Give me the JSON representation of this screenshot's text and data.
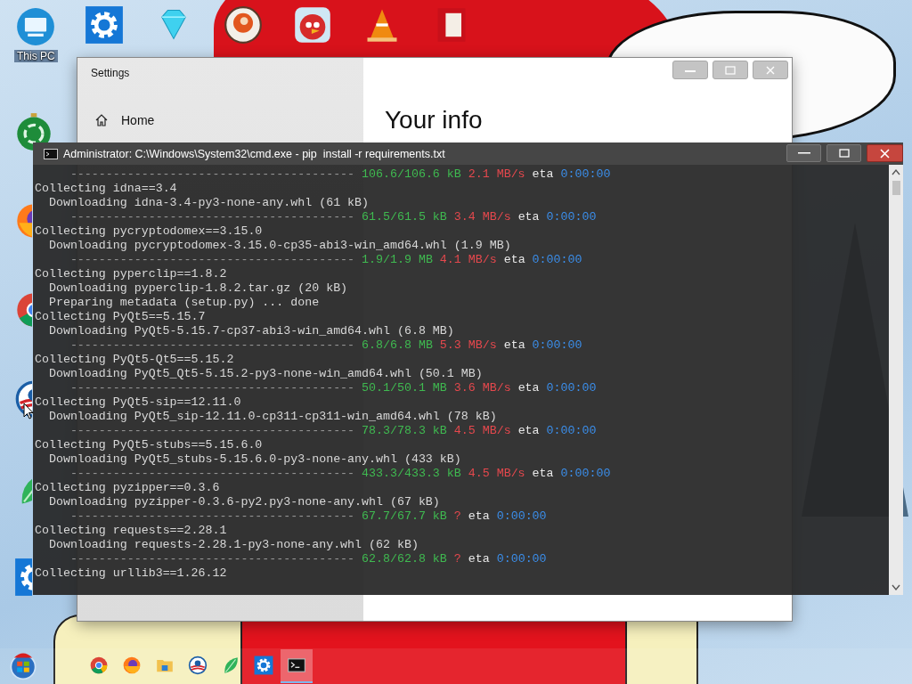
{
  "desktop": {
    "left_column": [
      {
        "kind": "monitor",
        "label": "This PC"
      },
      {
        "kind": "ornament"
      },
      {
        "kind": "globe"
      },
      {
        "kind": "wheel"
      },
      {
        "kind": "emblem"
      },
      {
        "kind": "leaf"
      },
      {
        "kind": "gear"
      }
    ],
    "top_row": [
      {
        "kind": "gear"
      },
      {
        "kind": "diamond"
      },
      {
        "kind": "ball"
      },
      {
        "kind": "bird"
      },
      {
        "kind": "cone"
      },
      {
        "kind": "card"
      }
    ]
  },
  "settings_window": {
    "title": "Settings",
    "nav": [
      {
        "label": "Home"
      }
    ],
    "heading": "Your info"
  },
  "cmd_window": {
    "title": "Administrator: C:\\Windows\\System32\\cmd.exe - pip  install -r requirements.txt",
    "lines": [
      {
        "kind": "progress",
        "bar": "----------------------------------------",
        "size": "106.6/106.6 kB",
        "speed": "2.1 MB/s",
        "eta_label": "eta",
        "eta": "0:00:00"
      },
      {
        "kind": "item",
        "text": "Collecting idna==3.4"
      },
      {
        "kind": "detail",
        "text": "Downloading idna-3.4-py3-none-any.whl (61 kB)"
      },
      {
        "kind": "progress",
        "bar": "----------------------------------------",
        "size": "61.5/61.5 kB",
        "speed": "3.4 MB/s",
        "eta_label": "eta",
        "eta": "0:00:00"
      },
      {
        "kind": "item",
        "text": "Collecting pycryptodomex==3.15.0"
      },
      {
        "kind": "detail",
        "text": "Downloading pycryptodomex-3.15.0-cp35-abi3-win_amd64.whl (1.9 MB)"
      },
      {
        "kind": "progress",
        "bar": "----------------------------------------",
        "size": "1.9/1.9 MB",
        "speed": "4.1 MB/s",
        "eta_label": "eta",
        "eta": "0:00:00"
      },
      {
        "kind": "item",
        "text": "Collecting pyperclip==1.8.2"
      },
      {
        "kind": "detail",
        "text": "Downloading pyperclip-1.8.2.tar.gz (20 kB)"
      },
      {
        "kind": "detail",
        "text": "Preparing metadata (setup.py) ... done"
      },
      {
        "kind": "item",
        "text": "Collecting PyQt5==5.15.7"
      },
      {
        "kind": "detail",
        "text": "Downloading PyQt5-5.15.7-cp37-abi3-win_amd64.whl (6.8 MB)"
      },
      {
        "kind": "progress",
        "bar": "----------------------------------------",
        "size": "6.8/6.8 MB",
        "speed": "5.3 MB/s",
        "eta_label": "eta",
        "eta": "0:00:00"
      },
      {
        "kind": "item",
        "text": "Collecting PyQt5-Qt5==5.15.2"
      },
      {
        "kind": "detail",
        "text": "Downloading PyQt5_Qt5-5.15.2-py3-none-win_amd64.whl (50.1 MB)"
      },
      {
        "kind": "progress",
        "bar": "----------------------------------------",
        "size": "50.1/50.1 MB",
        "speed": "3.6 MB/s",
        "eta_label": "eta",
        "eta": "0:00:00"
      },
      {
        "kind": "item",
        "text": "Collecting PyQt5-sip==12.11.0"
      },
      {
        "kind": "detail",
        "text": "Downloading PyQt5_sip-12.11.0-cp311-cp311-win_amd64.whl (78 kB)"
      },
      {
        "kind": "progress",
        "bar": "----------------------------------------",
        "size": "78.3/78.3 kB",
        "speed": "4.5 MB/s",
        "eta_label": "eta",
        "eta": "0:00:00"
      },
      {
        "kind": "item",
        "text": "Collecting PyQt5-stubs==5.15.6.0"
      },
      {
        "kind": "detail",
        "text": "Downloading PyQt5_stubs-5.15.6.0-py3-none-any.whl (433 kB)"
      },
      {
        "kind": "progress",
        "bar": "----------------------------------------",
        "size": "433.3/433.3 kB",
        "speed": "4.5 MB/s",
        "eta_label": "eta",
        "eta": "0:00:00"
      },
      {
        "kind": "item",
        "text": "Collecting pyzipper==0.3.6"
      },
      {
        "kind": "detail",
        "text": "Downloading pyzipper-0.3.6-py2.py3-none-any.whl (67 kB)"
      },
      {
        "kind": "progress",
        "bar": "----------------------------------------",
        "size": "67.7/67.7 kB",
        "speed": "?",
        "eta_label": "eta",
        "eta": "0:00:00"
      },
      {
        "kind": "item",
        "text": "Collecting requests==2.28.1"
      },
      {
        "kind": "detail",
        "text": "Downloading requests-2.28.1-py3-none-any.whl (62 kB)"
      },
      {
        "kind": "progress",
        "bar": "----------------------------------------",
        "size": "62.8/62.8 kB",
        "speed": "?",
        "eta_label": "eta",
        "eta": "0:00:00"
      },
      {
        "kind": "item",
        "text": "Collecting urllib3==1.26.12"
      }
    ]
  },
  "taskbar": {
    "items": [
      {
        "kind": "start",
        "selected": false
      },
      {
        "kind": "wheel",
        "selected": false
      },
      {
        "kind": "globe",
        "selected": false
      },
      {
        "kind": "folder",
        "selected": false
      },
      {
        "kind": "emblem",
        "selected": false
      },
      {
        "kind": "leaf",
        "selected": false
      },
      {
        "kind": "gear",
        "selected": false
      },
      {
        "kind": "console",
        "selected": true
      }
    ]
  }
}
